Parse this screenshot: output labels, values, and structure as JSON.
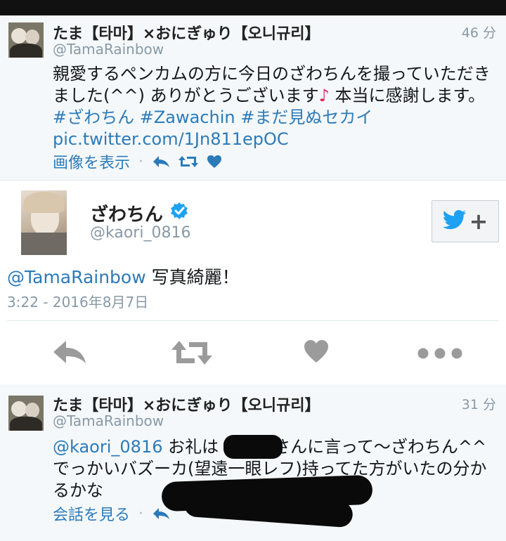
{
  "tweet1": {
    "name": "たま【타마】×おにぎゅり【오니규리】",
    "handle": "@TamaRainbow",
    "time": "46 分",
    "text_main": "親愛するペンカムの方に今日のざわちんを撮っていただきました(^^) ありがとうございます",
    "note": "♪",
    "text_tail": " 本当に感謝します。",
    "hashtags": " #ざわちん #Zawachin #まだ見ぬセカイ",
    "pic_link": "pic.twitter.com/1Jn811epOC",
    "action_label": "画像を表示",
    "separator": "·"
  },
  "main_tweet": {
    "name": "ざわちん",
    "handle": "@kaori_0816",
    "mention": "@TamaRainbow",
    "text": " 写真綺麗！",
    "date": "3:22 - 2016年8月7日",
    "follow_plus": "+"
  },
  "tweet2": {
    "name": "たま【타마】×おにぎゅり【오니규리】",
    "handle": "@TamaRainbow",
    "time": "31 分",
    "mention": "@kaori_0816",
    "text_a": " お礼は",
    "text_b": "さんに言って〜ざわちん^^ でっかいバズーカ(望遠一眼レフ)持ってた方がいたの分かるかな",
    "action_label": "会話を見る",
    "separator": "·"
  },
  "colors": {
    "link": "#2b7bb9",
    "muted": "#8899a6",
    "background": "#f5f8fa",
    "card": "#ffffff",
    "twitter_blue": "#1da1f2"
  },
  "icons": [
    "reply-icon",
    "retweet-icon",
    "like-icon",
    "more-icon",
    "verified-icon",
    "twitter-bird-icon"
  ]
}
